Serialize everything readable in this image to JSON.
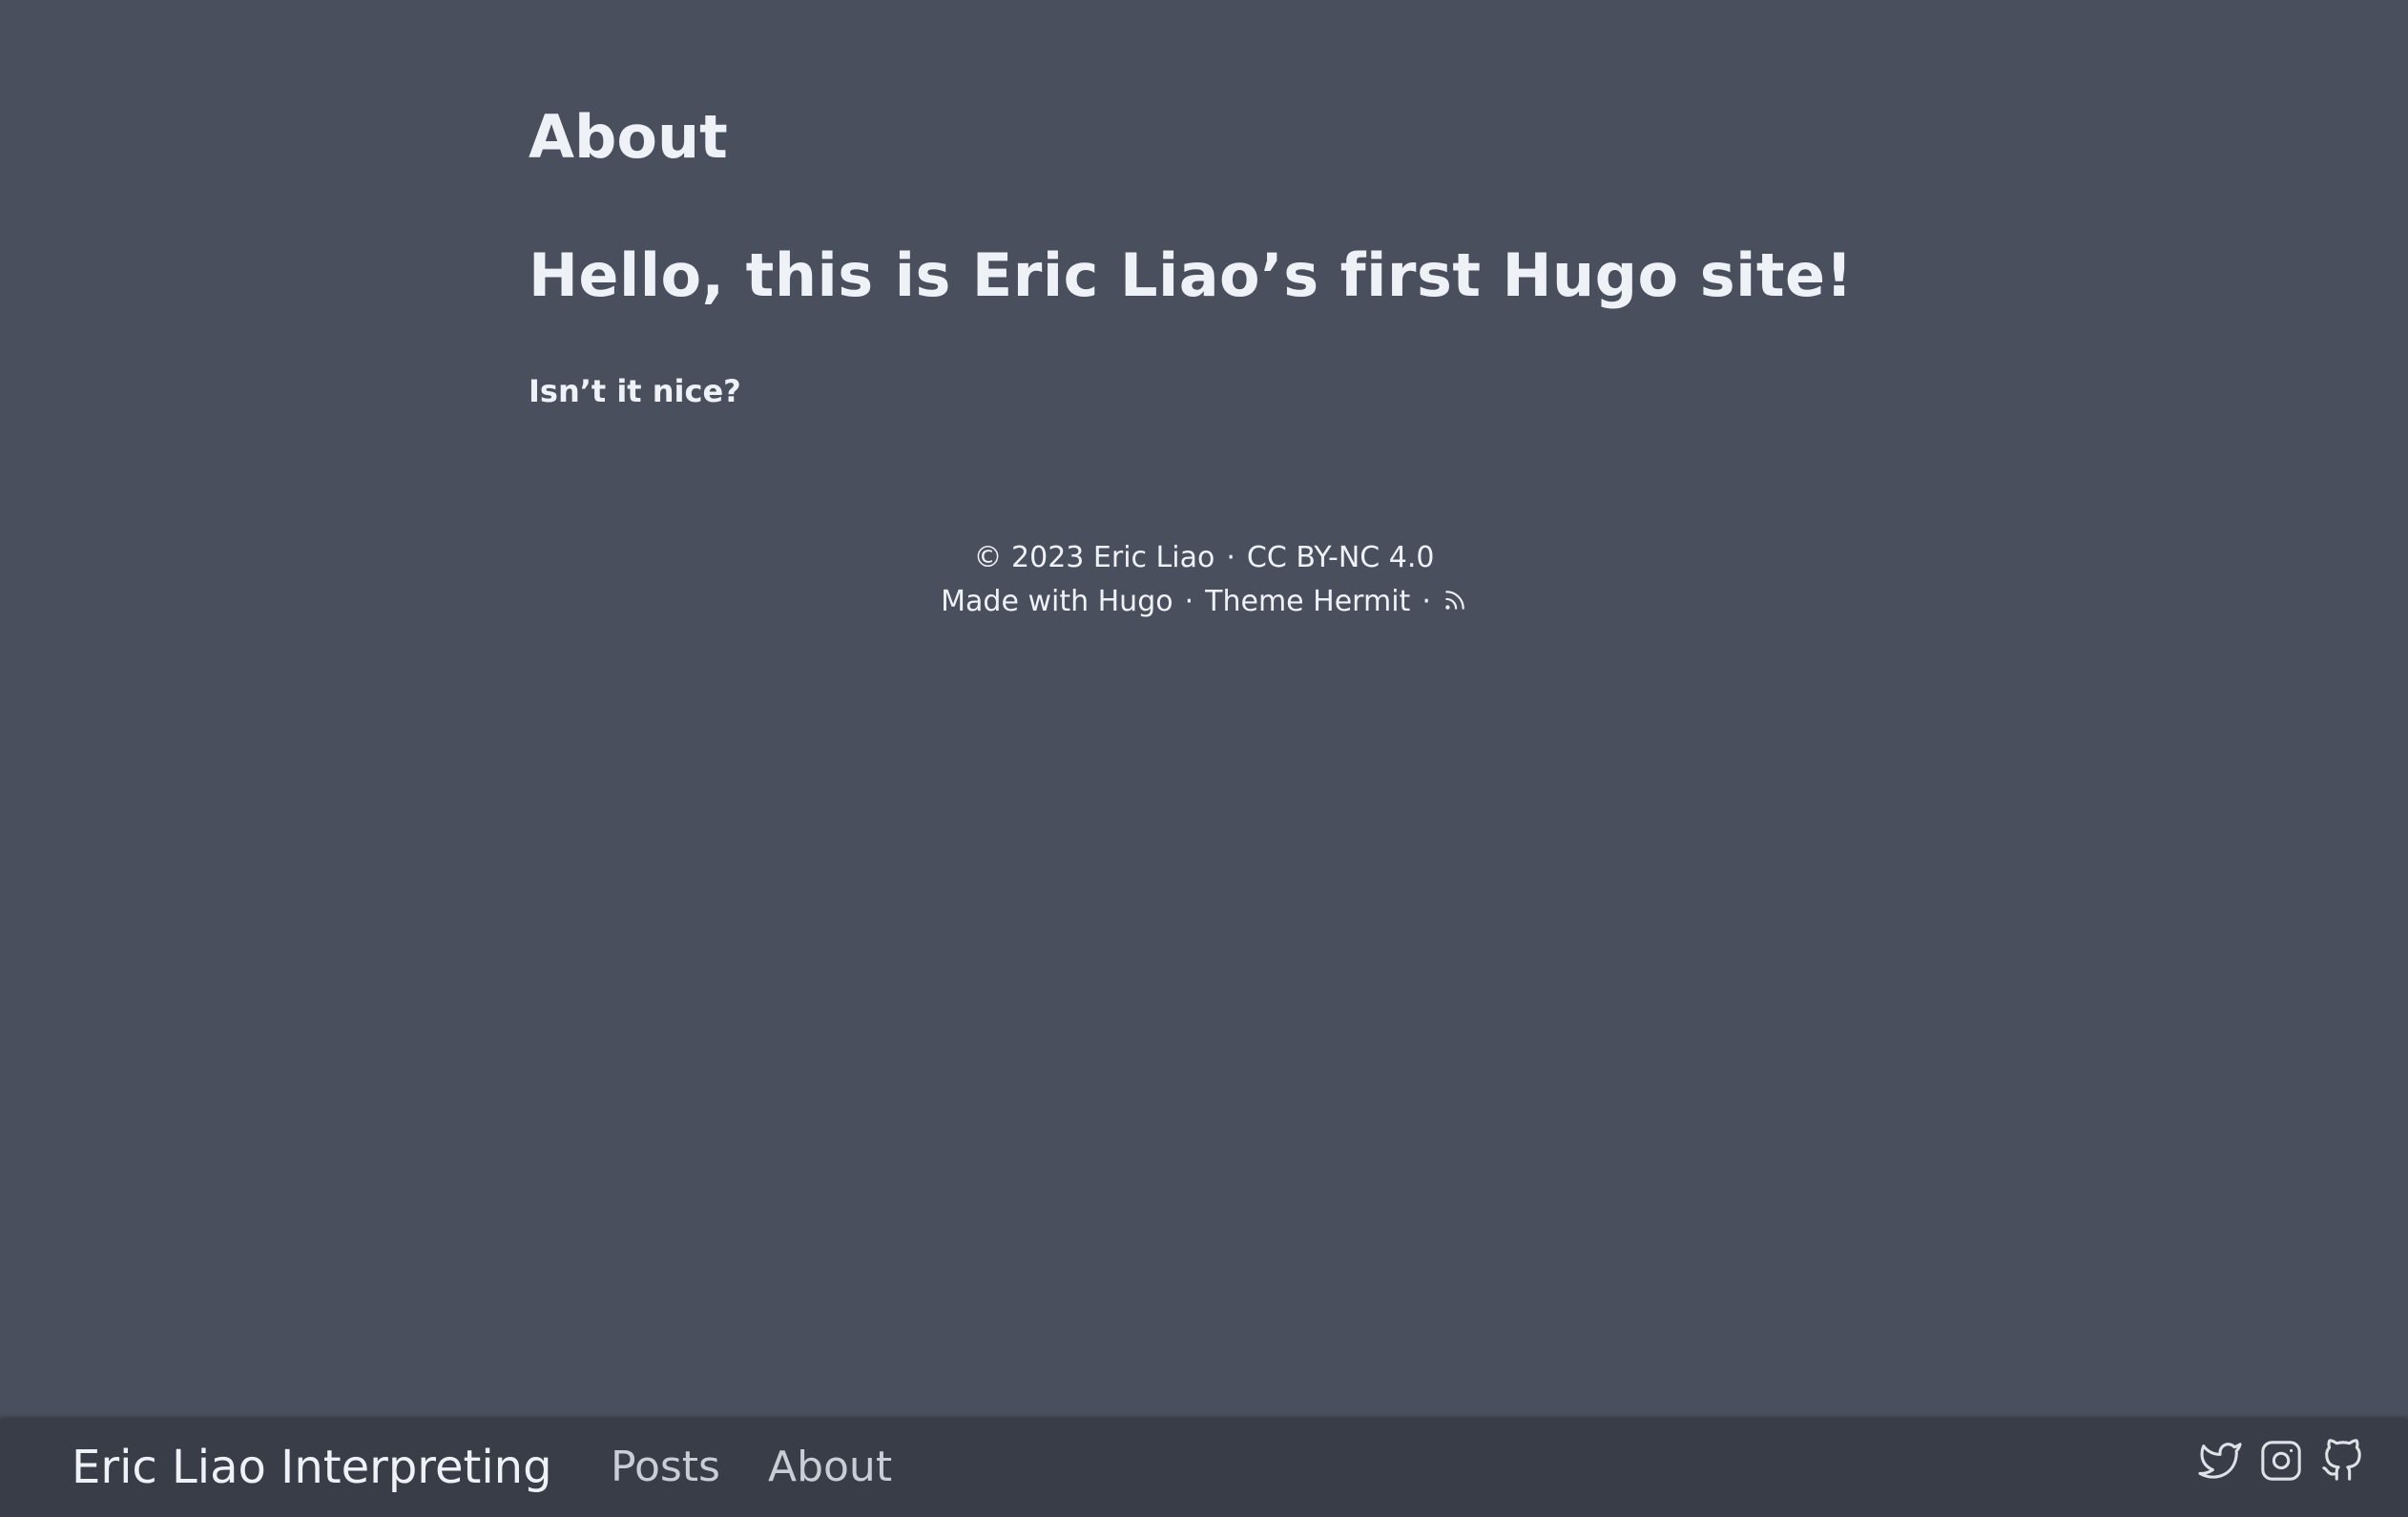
{
  "page": {
    "title": "About"
  },
  "content": {
    "heading": "Hello, this is Eric Liao’s first Hugo site!",
    "text": "Isn’t it nice?"
  },
  "footer": {
    "copyright": "© 2023 Eric Liao",
    "separator": "·",
    "license": "CC BY-NC 4.0",
    "made_with": "Made with Hugo",
    "theme": "Theme Hermit",
    "rss_icon": "rss-icon"
  },
  "header": {
    "site_name": "Eric Liao Interpreting",
    "nav": [
      {
        "label": "Posts"
      },
      {
        "label": "About"
      }
    ],
    "social": [
      {
        "icon": "twitter-icon"
      },
      {
        "icon": "instagram-icon"
      },
      {
        "icon": "github-icon"
      }
    ]
  },
  "colors": {
    "background": "#494f5c",
    "header_background": "#393d48",
    "text": "#eef1f5",
    "nav_text": "#c9ced6"
  }
}
